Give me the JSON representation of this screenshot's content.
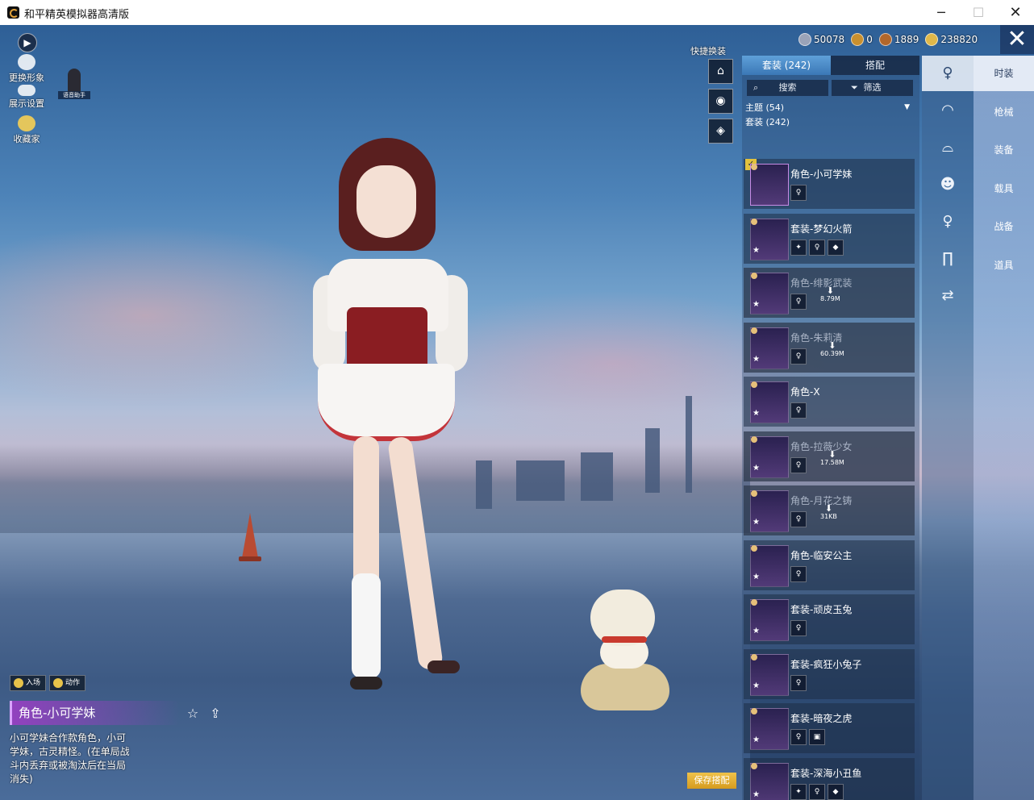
{
  "window": {
    "title": "和平精英模拟器高清版",
    "min": "─",
    "max": "☐",
    "close": "✕"
  },
  "left_tools": [
    {
      "label": "更换形象"
    },
    {
      "label": "展示设置"
    },
    {
      "label": "收藏家"
    }
  ],
  "assistant_label": "语音助手",
  "currencies": [
    {
      "value": "50078",
      "color": "#9aa3b8"
    },
    {
      "value": "0",
      "color": "#c9902f"
    },
    {
      "value": "1889",
      "color": "#b2672b"
    },
    {
      "value": "238820",
      "color": "#e0b84a"
    }
  ],
  "quick_swap": "快捷换装",
  "panel": {
    "tabs": [
      "套装 (242)",
      "搭配"
    ],
    "search": "搜索",
    "filter": "筛选",
    "theme": "主题 (54)",
    "suit_count": "套装 (242)"
  },
  "items": [
    {
      "name": "角色-小可学妹",
      "parts": [
        "♀"
      ],
      "dim": false,
      "download": ""
    },
    {
      "name": "套装-梦幻火箭",
      "parts": [
        "✦",
        "♀",
        "◆"
      ],
      "dim": false,
      "download": ""
    },
    {
      "name": "角色-绯影武装",
      "parts": [
        "♀"
      ],
      "dim": true,
      "download": "8.79M"
    },
    {
      "name": "角色-朱莉清",
      "parts": [
        "♀"
      ],
      "dim": true,
      "download": "60.39M"
    },
    {
      "name": "角色-X",
      "parts": [
        "♀"
      ],
      "dim": false,
      "download": ""
    },
    {
      "name": "角色-拉薇少女",
      "parts": [
        "♀"
      ],
      "dim": true,
      "download": "17.58M"
    },
    {
      "name": "角色-月花之铸",
      "parts": [
        "♀"
      ],
      "dim": true,
      "download": "31KB"
    },
    {
      "name": "角色-临安公主",
      "parts": [
        "♀"
      ],
      "dim": false,
      "download": ""
    },
    {
      "name": "套装-顽皮玉兔",
      "parts": [
        "♀"
      ],
      "dim": false,
      "download": ""
    },
    {
      "name": "套装-疯狂小兔子",
      "parts": [
        "♀"
      ],
      "dim": false,
      "download": ""
    },
    {
      "name": "套装-暗夜之虎",
      "parts": [
        "♀",
        "▣"
      ],
      "dim": false,
      "download": ""
    },
    {
      "name": "套装-深海小丑鱼",
      "parts": [
        "✦",
        "♀",
        "◆"
      ],
      "dim": false,
      "download": ""
    }
  ],
  "categories": [
    "♀",
    "◠",
    "⌓",
    "☻",
    "♀",
    "∏",
    "⇄"
  ],
  "menu": [
    "时装",
    "枪械",
    "装备",
    "载具",
    "战备",
    "道具"
  ],
  "action_tabs": [
    "入场",
    "动作"
  ],
  "outfit": {
    "name": "角色-小可学妹",
    "desc": "小可学妹合作款角色，小可学妹，古灵精怪。(在单局战斗内丢弃或被淘汰后在当局消失)"
  },
  "save_button": "保存搭配"
}
